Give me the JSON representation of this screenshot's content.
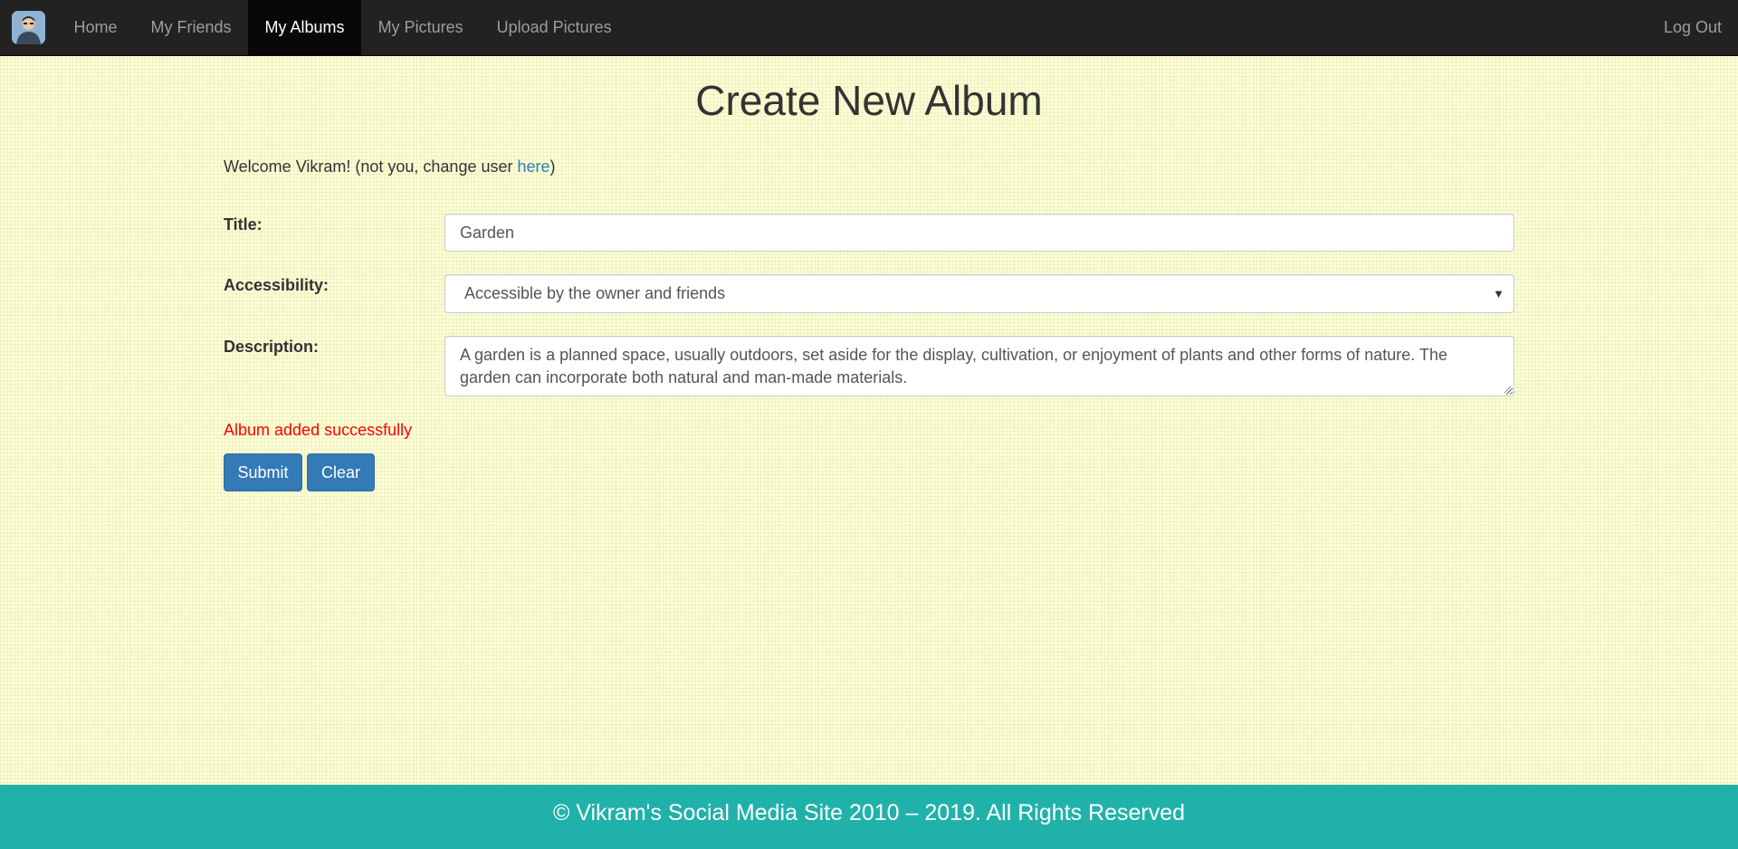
{
  "navbar": {
    "brand_icon": "user-avatar-icon",
    "items": [
      {
        "label": "Home",
        "active": false
      },
      {
        "label": "My Friends",
        "active": false
      },
      {
        "label": "My Albums",
        "active": true
      },
      {
        "label": "My Pictures",
        "active": false
      },
      {
        "label": "Upload Pictures",
        "active": false
      }
    ],
    "logout_label": "Log Out"
  },
  "main": {
    "title": "Create New Album",
    "welcome": {
      "prefix": "Welcome Vikram! (not you, change user ",
      "link_text": "here",
      "suffix": ")"
    },
    "form": {
      "title_label": "Title:",
      "title_value": "Garden",
      "accessibility_label": "Accessibility:",
      "accessibility_value": "Accessible by the owner and friends",
      "description_label": "Description:",
      "description_value": "A garden is a planned space, usually outdoors, set aside for the display, cultivation, or enjoyment of plants and other forms of nature. The garden can incorporate both natural and man-made materials.",
      "status_message": "Album added successfully",
      "submit_label": "Submit",
      "clear_label": "Clear"
    }
  },
  "footer": {
    "text": "© Vikram's Social Media Site 2010 – 2019. All Rights Reserved"
  },
  "colors": {
    "navbar_bg": "#222222",
    "nav_active_bg": "#080808",
    "page_bg": "#fdfdd9",
    "link": "#337ab7",
    "button": "#337ab7",
    "success_text": "#ff0000",
    "footer_bg": "#20b2aa"
  }
}
